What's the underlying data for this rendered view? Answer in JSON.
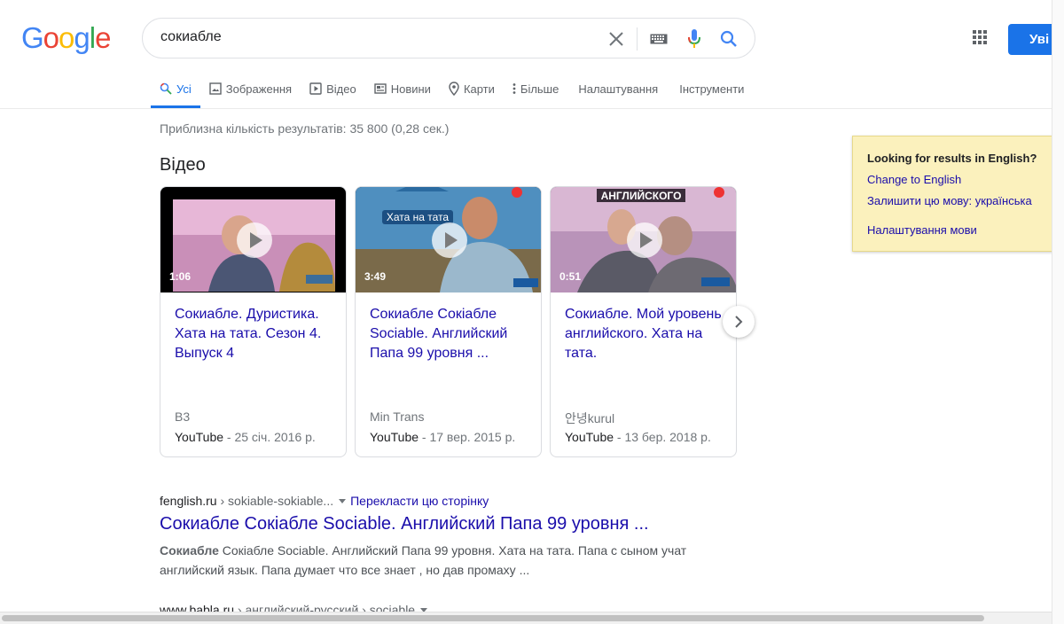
{
  "header": {
    "logo": [
      "G",
      "o",
      "o",
      "g",
      "l",
      "e"
    ],
    "logo_colors": [
      "#4285f4",
      "#ea4335",
      "#fbbc05",
      "#4285f4",
      "#34a853",
      "#ea4335"
    ],
    "query": "сокиабле",
    "signin_label": "Уві"
  },
  "tabs": [
    {
      "label": "Усі",
      "icon": "search-icon"
    },
    {
      "label": "Зображення",
      "icon": "image-icon"
    },
    {
      "label": "Відео",
      "icon": "play-icon"
    },
    {
      "label": "Новини",
      "icon": "news-icon"
    },
    {
      "label": "Карти",
      "icon": "map-pin-icon"
    },
    {
      "label": "Більше",
      "icon": "more-vert-icon"
    },
    {
      "label": "Налаштування"
    },
    {
      "label": "Інструменти"
    }
  ],
  "result_stats": "Приблизна кількість результатів: 35 800 (0,28 сек.)",
  "videos": {
    "heading": "Відео",
    "items": [
      {
        "duration": "1:06",
        "title": "Сокиабле. Дуристика. Хата на тата. Сезон 4. Выпуск 4",
        "author": "B3",
        "source": "YouTube",
        "date": " - 25 січ. 2016 р."
      },
      {
        "duration": "3:49",
        "title": "Сокиабле Сокіабле Sociable. Английский Папа 99 уровня ...",
        "author": "Min Trans",
        "source": "YouTube",
        "date": " - 17 вер. 2015 р."
      },
      {
        "duration": "0:51",
        "title": "Сокиабле. Мой уровень английского. Хата на тата.",
        "author": "안녕kurul",
        "source": "YouTube",
        "date": " - 13 бер. 2018 р."
      }
    ],
    "thumb_texts": [
      "Хата на тата",
      "АНГЛИЙСКОГО"
    ]
  },
  "language_panel": {
    "question": "Looking for results in English?",
    "change": "Change to English",
    "keep": "Залишити цю мову: українська",
    "settings": "Налаштування мови"
  },
  "results": [
    {
      "site": "fenglish.ru",
      "crumb": " › sokiable-sokiable...",
      "translate": "Перекласти цю сторінку",
      "title": "Сокиабле Сокiабле Sociable. Английский Папа 99 уровня ...",
      "snippet_bold": "Сокиабле",
      "snippet": " Сокiабле Sociable. Английский Папа 99 уровня. Хата на тата. Папа с сыном учат английский язык. Папа думает что все знает , но дав промаху ..."
    },
    {
      "site": "www.babla.ru",
      "crumb": " › английский-русский › sociable"
    }
  ]
}
